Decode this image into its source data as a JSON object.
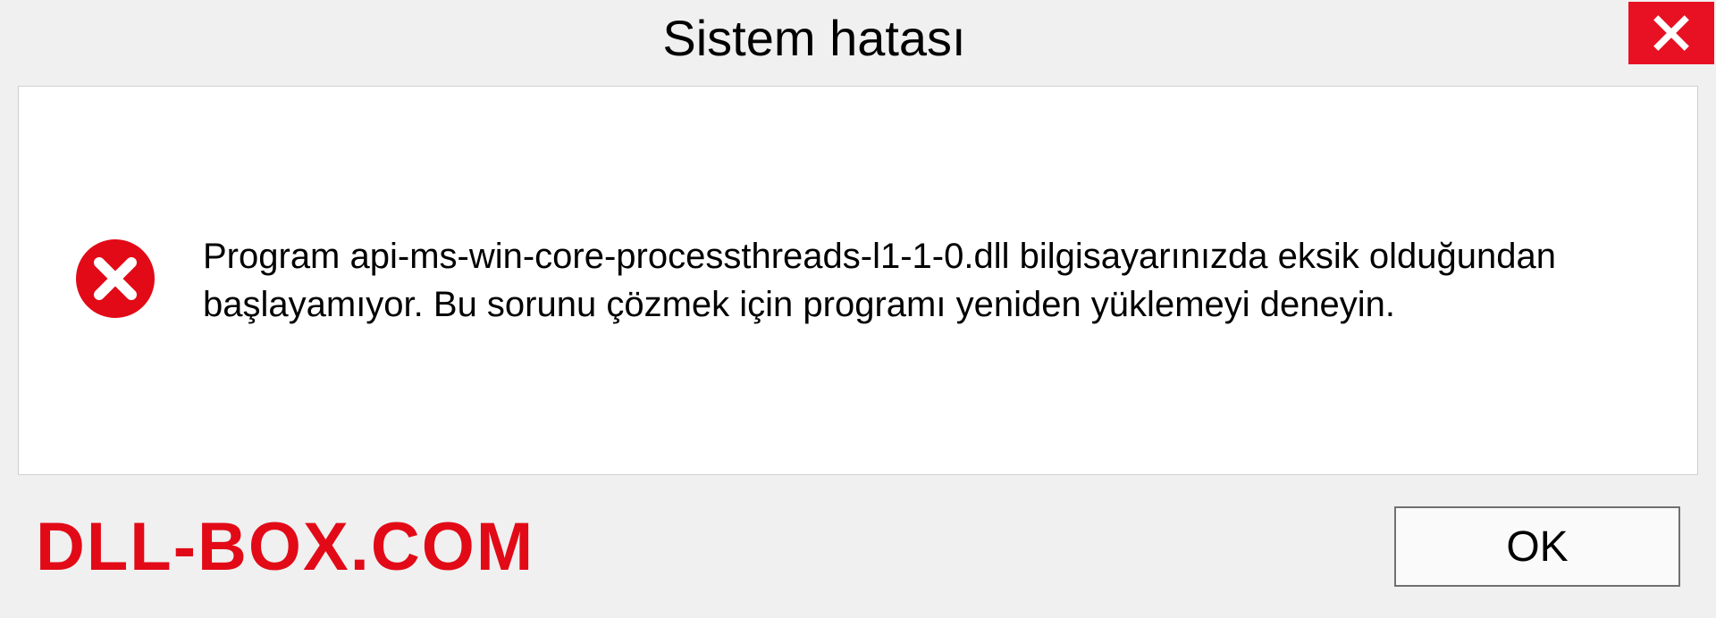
{
  "titlebar": {
    "title": "Sistem hatası"
  },
  "dialog": {
    "message": "Program api-ms-win-core-processthreads-l1-1-0.dll bilgisayarınızda eksik olduğundan başlayamıyor. Bu sorunu çözmek için programı yeniden yüklemeyi deneyin."
  },
  "footer": {
    "brand": "DLL-BOX.COM",
    "ok_label": "OK"
  },
  "colors": {
    "close_bg": "#e81123",
    "brand_color": "#e20a17"
  }
}
